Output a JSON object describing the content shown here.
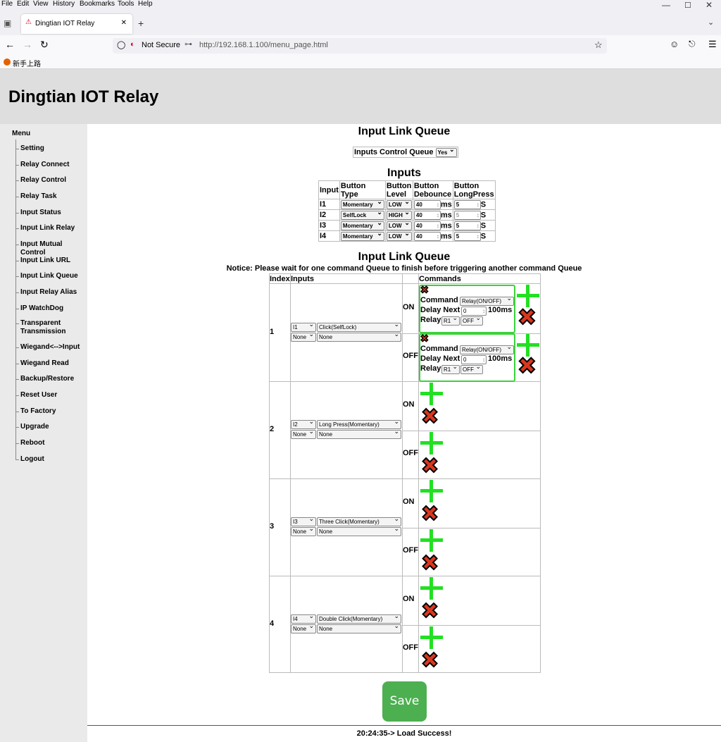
{
  "browser": {
    "menus": [
      "File",
      "Edit",
      "View",
      "History",
      "Bookmarks",
      "Tools",
      "Help"
    ],
    "tab_title": "Dingtian IOT Relay",
    "security_label": "Not Secure",
    "url": "http://192.168.1.100/menu_page.html",
    "bookmark": "新手上路"
  },
  "header": {
    "title": "Dingtian IOT Relay"
  },
  "sidebar": {
    "title": "Menu",
    "items": [
      "Setting",
      "Relay Connect",
      "Relay Control",
      "Relay Task",
      "Input Status",
      "Input Link Relay",
      "Input Mutual Control",
      "Input Link URL",
      "Input Link Queue",
      "Input Relay Alias",
      "IP WatchDog",
      "Transparent Transmission",
      "Wiegand<-->Input",
      "Wiegand Read",
      "Backup/Restore",
      "Reset User",
      "To Factory",
      "Upgrade",
      "Reboot",
      "Logout"
    ]
  },
  "main": {
    "page_title": "Input Link Queue",
    "control_label": "Inputs Control Queue",
    "control_value": "Yes",
    "inputs_title": "Inputs",
    "inputs_headers": [
      "Input",
      "Button Type",
      "Button Level",
      "Button Debounce",
      "Button LongPress"
    ],
    "inputs": [
      {
        "name": "I1",
        "type": "Momentary",
        "level": "LOW",
        "debounce": "40",
        "ms": "ms",
        "longpress": "5",
        "s": "S"
      },
      {
        "name": "I2",
        "type": "SelfLock",
        "level": "HIGH",
        "debounce": "40",
        "ms": "ms",
        "longpress": "5",
        "s": "S"
      },
      {
        "name": "I3",
        "type": "Momentary",
        "level": "LOW",
        "debounce": "40",
        "ms": "ms",
        "longpress": "5",
        "s": "S"
      },
      {
        "name": "I4",
        "type": "Momentary",
        "level": "LOW",
        "debounce": "40",
        "ms": "ms",
        "longpress": "5",
        "s": "S"
      }
    ],
    "queue_title": "Input Link Queue",
    "notice": "Notice: Please wait for one command Queue to finish before triggering another command Queue",
    "queue_headers": [
      "Index",
      "Inputs",
      "Commands"
    ],
    "cmd_labels": {
      "command": "Command",
      "delay": "Delay Next",
      "unit": "100ms",
      "relay": "Relay"
    },
    "queues": [
      {
        "index": "1",
        "input": "I1",
        "trigger": "Click(SelfLock)",
        "input2": "None",
        "trigger2": "None",
        "on": "ON",
        "off": "OFF",
        "on_cmd": {
          "command": "Relay(ON/OFF)",
          "delay": "0",
          "relay": "R1",
          "state": "OFF"
        },
        "off_cmd": {
          "command": "Relay(ON/OFF)",
          "delay": "0",
          "relay": "R1",
          "state": "OFF"
        }
      },
      {
        "index": "2",
        "input": "I2",
        "trigger": "Long Press(Momentary)",
        "input2": "None",
        "trigger2": "None",
        "on": "ON",
        "off": "OFF"
      },
      {
        "index": "3",
        "input": "I3",
        "trigger": "Three Click(Momentary)",
        "input2": "None",
        "trigger2": "None",
        "on": "ON",
        "off": "OFF"
      },
      {
        "index": "4",
        "input": "I4",
        "trigger": "Double Click(Momentary)",
        "input2": "None",
        "trigger2": "None",
        "on": "ON",
        "off": "OFF"
      }
    ],
    "save_label": "Save",
    "status": "20:24:35-> Load Success!"
  }
}
